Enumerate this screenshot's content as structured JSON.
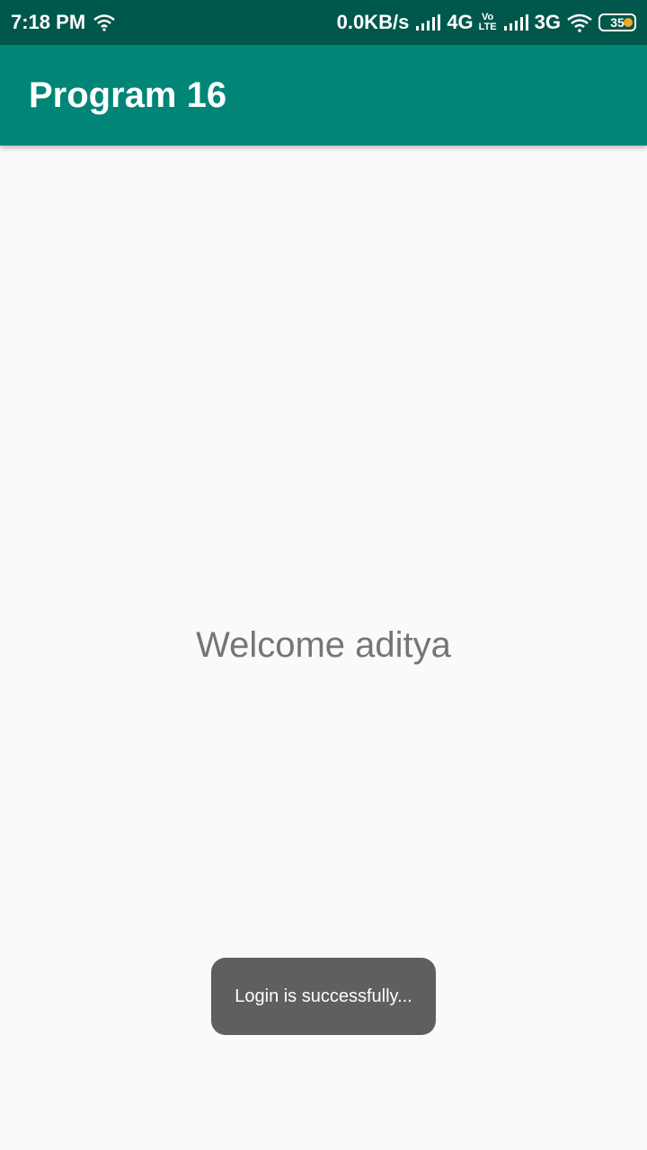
{
  "status_bar": {
    "time": "7:18 PM",
    "data_rate": "0.0KB/s",
    "network_1": "4G",
    "volte_top": "Vo",
    "volte_bottom": "LTE",
    "network_2": "3G",
    "battery": "35",
    "icons": [
      "wifi-icon",
      "signal-icon",
      "battery-icon"
    ],
    "battery_dot_color": "#f5a623"
  },
  "app_bar": {
    "title": "Program 16",
    "color": "#008577"
  },
  "main": {
    "welcome_text": "Welcome aditya"
  },
  "toast": {
    "message": "Login is successfully..."
  }
}
